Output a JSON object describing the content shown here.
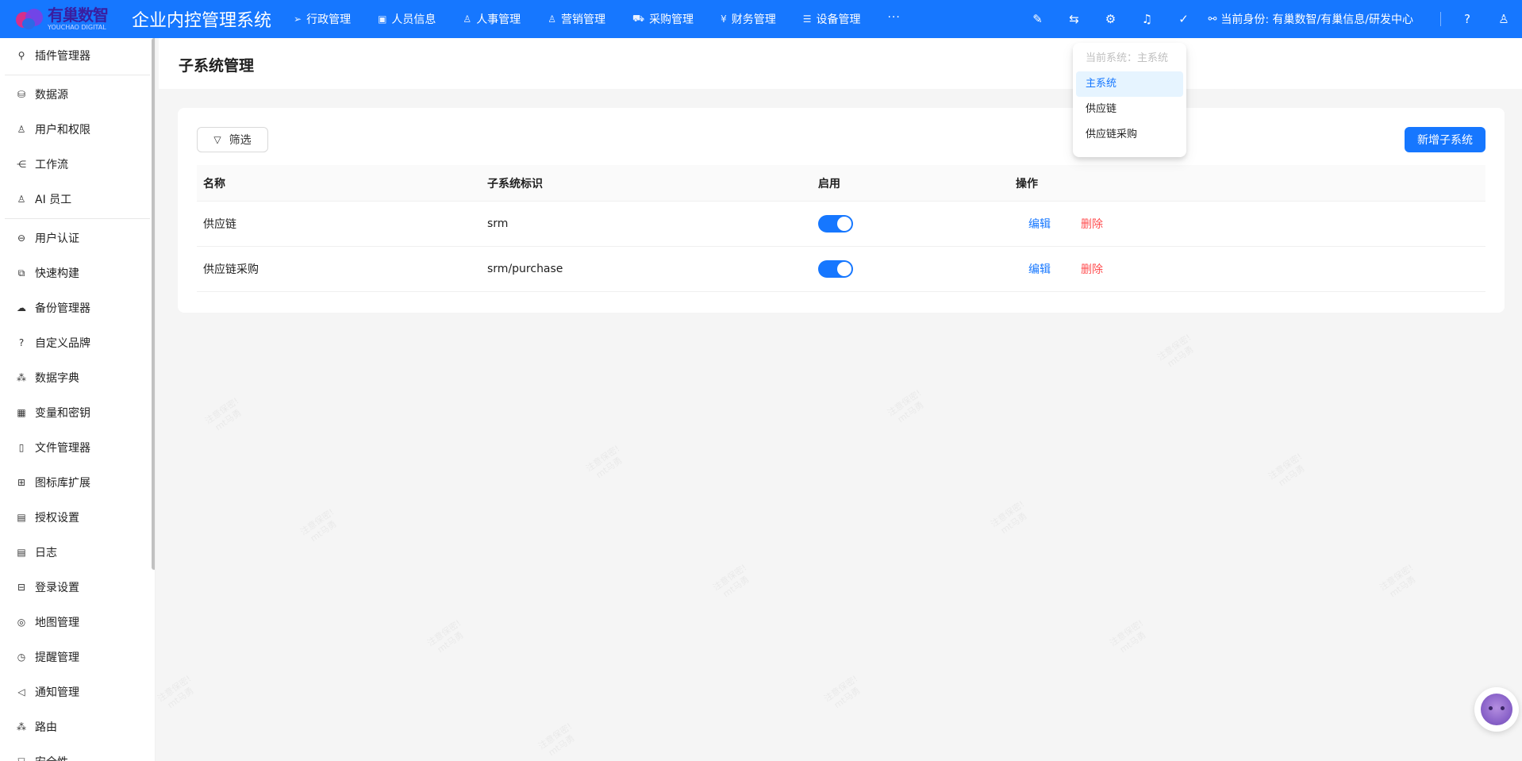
{
  "header": {
    "logo_text": "有巢数智",
    "logo_subtext": "YOUCHAO DIGITAL",
    "app_title": "企业内控管理系统",
    "nav": [
      {
        "label": "行政管理",
        "icon": "send-icon"
      },
      {
        "label": "人员信息",
        "icon": "id-card-icon"
      },
      {
        "label": "人事管理",
        "icon": "user-icon"
      },
      {
        "label": "营销管理",
        "icon": "user-icon"
      },
      {
        "label": "采购管理",
        "icon": "cart-icon"
      },
      {
        "label": "财务管理",
        "icon": "yen-circle-icon"
      },
      {
        "label": "设备管理",
        "icon": "device-icon"
      }
    ],
    "more_label": "···",
    "identity": "当前身份: 有巢数智/有巢信息/研发中心"
  },
  "sidebar": {
    "items": [
      {
        "label": "插件管理器",
        "icon": "plug-icon"
      },
      {
        "label": "数据源",
        "icon": "database-icon"
      },
      {
        "label": "用户和权限",
        "icon": "users-icon"
      },
      {
        "label": "工作流",
        "icon": "workflow-icon"
      },
      {
        "label": "AI 员工",
        "icon": "robot-icon"
      },
      {
        "label": "用户认证",
        "icon": "login-icon"
      },
      {
        "label": "快速构建",
        "icon": "blocks-icon"
      },
      {
        "label": "备份管理器",
        "icon": "cloud-icon"
      },
      {
        "label": "自定义品牌",
        "icon": "question-circle-icon"
      },
      {
        "label": "数据字典",
        "icon": "cluster-icon"
      },
      {
        "label": "变量和密钥",
        "icon": "table-icon"
      },
      {
        "label": "文件管理器",
        "icon": "file-icon"
      },
      {
        "label": "图标库扩展",
        "icon": "grid-icon"
      },
      {
        "label": "授权设置",
        "icon": "audit-icon"
      },
      {
        "label": "日志",
        "icon": "file-text-icon"
      },
      {
        "label": "登录设置",
        "icon": "sliders-icon"
      },
      {
        "label": "地图管理",
        "icon": "location-icon"
      },
      {
        "label": "提醒管理",
        "icon": "clock-icon"
      },
      {
        "label": "通知管理",
        "icon": "megaphone-icon"
      },
      {
        "label": "路由",
        "icon": "route-icon"
      },
      {
        "label": "安全性",
        "icon": "shield-icon"
      }
    ]
  },
  "page": {
    "title": "子系统管理",
    "filter_label": "筛选",
    "add_label": "新增子系统"
  },
  "table": {
    "headers": [
      "名称",
      "子系统标识",
      "启用",
      "操作"
    ],
    "rows": [
      {
        "name": "供应链",
        "id": "srm",
        "enabled": true,
        "edit": "编辑",
        "delete": "删除"
      },
      {
        "name": "供应链采购",
        "id": "srm/purchase",
        "enabled": true,
        "edit": "编辑",
        "delete": "删除"
      }
    ]
  },
  "dropdown": {
    "header": "当前系统：主系统",
    "items": [
      "主系统",
      "供应链",
      "供应链采购"
    ],
    "selected": "主系统"
  },
  "colors": {
    "primary": "#1677ff",
    "danger": "#ff4d4f",
    "background": "#f5f5f5"
  }
}
